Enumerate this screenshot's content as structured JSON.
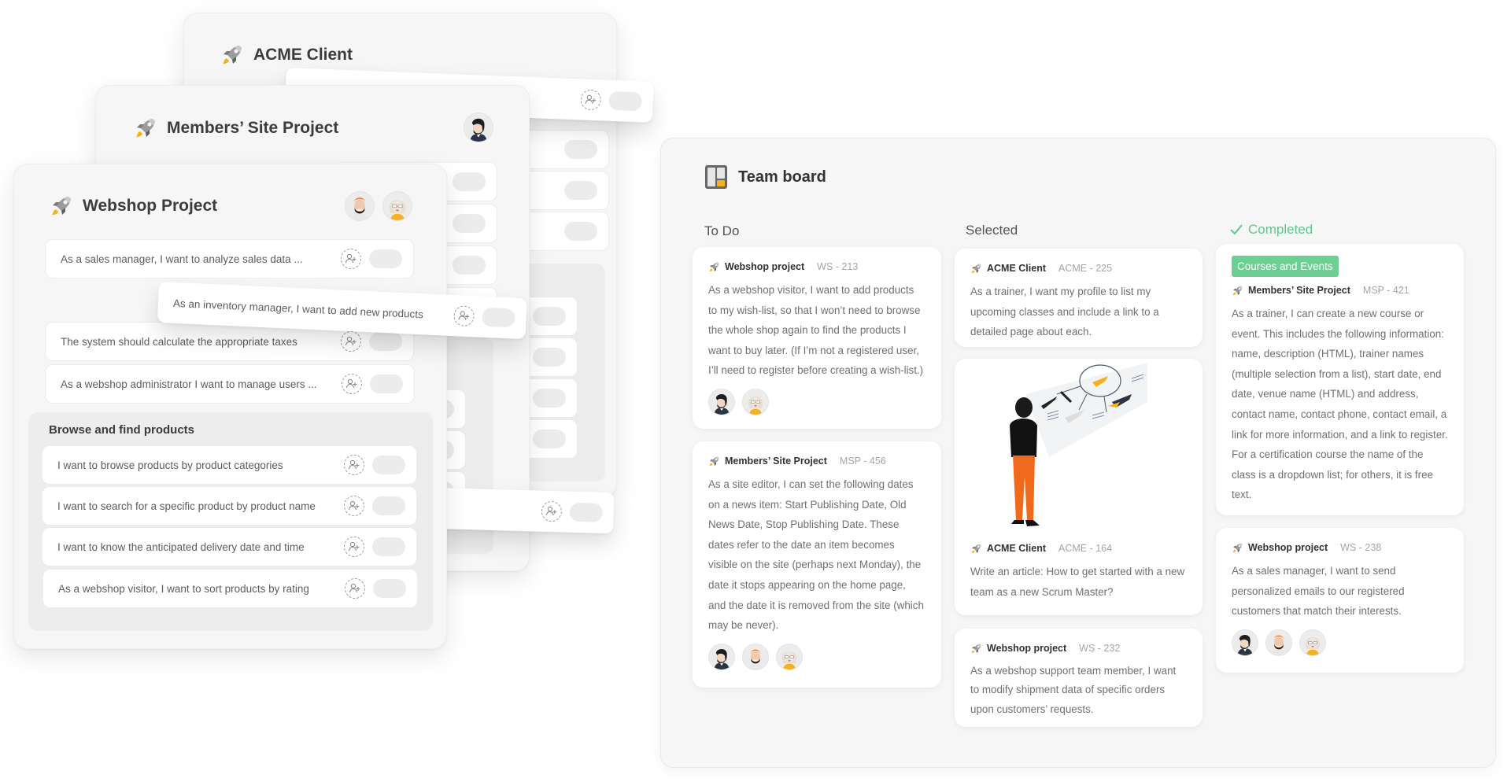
{
  "projects": {
    "acme": {
      "title": "ACME Client"
    },
    "members": {
      "title": "Members’ Site Project",
      "avatars": [
        "avatar-man-black-hair"
      ]
    },
    "webshop": {
      "title": "Webshop Project",
      "avatars": [
        "avatar-man-orange-hair",
        "avatar-woman-blonde"
      ],
      "stories": [
        "As a sales manager, I want to analyze sales data ...",
        "The system should calculate the appropriate taxes",
        "As a webshop administrator I want to manage users ..."
      ],
      "group": {
        "title": "Browse and find products",
        "stories": [
          "I want to browse products by product categories",
          "I want to search for a specific product by product name",
          "I want to know the anticipated delivery date and time",
          "As a webshop visitor, I want to sort products by rating"
        ]
      }
    },
    "dragged_story": "As an inventory manager, I want to add new products"
  },
  "board": {
    "title": "Team board",
    "columns": [
      {
        "name": "To Do",
        "cards": [
          {
            "project": "Webshop project",
            "id": "WS - 213",
            "text": "As a webshop visitor, I want to add products to my wish-list, so that I won’t need to browse the whole shop again to find the products I want to buy later. (If I’m not a registered user, I’ll need to register before creating a wish-list.)",
            "avatars": [
              "avatar-man-black-hair",
              "avatar-woman-blonde"
            ]
          },
          {
            "project": "Members’ Site Project",
            "id": "MSP - 456",
            "text": "As a site editor, I can set the following dates on a news item: Start Publishing Date, Old News Date, Stop Publishing Date. These dates refer to the date an item becomes visible on the site (perhaps next Monday), the date it stops appearing on the home page, and the date it is removed from the site (which may be never).",
            "avatars": [
              "avatar-man-black-hair",
              "avatar-man-orange-hair",
              "avatar-woman-blonde"
            ]
          }
        ]
      },
      {
        "name": "Selected",
        "cards": [
          {
            "project": "ACME Client",
            "id": "ACME - 225",
            "text": "As a trainer, I want my profile to list my upcoming classes and include a link to a detailed page about each."
          },
          {
            "project": "ACME Client",
            "id": "ACME - 164",
            "text": "Write an article: How to get started with a new team as a new Scrum Master?",
            "image": "illustration-person-viewing-planes"
          },
          {
            "project": "Webshop project",
            "id": "WS - 232",
            "text": "As a webshop support team member, I want to modify shipment data of specific orders upon customers’ requests."
          }
        ]
      },
      {
        "name": "Completed",
        "icon": "checkmark-icon",
        "color": "#5fc98a",
        "cards": [
          {
            "label": "Courses and Events",
            "project": "Members’ Site Project",
            "id": "MSP - 421",
            "text": "As a trainer, I can create a new course or event. This includes the following information: name, description (HTML), trainer names (multiple selection from a list), start date, end date, venue name (HTML) and address, contact name, contact phone, contact email, a link for more information, and a link to register. For a certification course the name of the class is a dropdown list; for others, it is free text."
          },
          {
            "project": "Webshop project",
            "id": "WS - 238",
            "text": "As a sales manager, I want to send personalized emails to our registered customers that match their interests.",
            "avatars": [
              "avatar-man-black-hair",
              "avatar-man-orange-hair",
              "avatar-woman-blonde"
            ]
          }
        ]
      }
    ]
  },
  "colors": {
    "accent_green": "#6ccf94",
    "rocket_yellow": "#f5b21e",
    "card_bg": "#f6f6f6"
  }
}
